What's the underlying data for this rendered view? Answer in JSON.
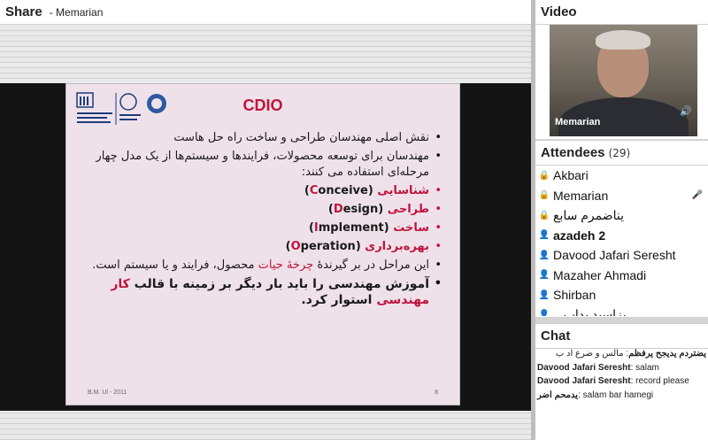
{
  "share": {
    "title": "Share",
    "presenter": "- Memarian",
    "slide": {
      "title": "CDIO",
      "bullets": [
        {
          "segments": [
            {
              "t": "نقش اصلی مهندسان طراحی و ساخت راه حل هاست"
            }
          ]
        },
        {
          "segments": [
            {
              "t": "مهندسان برای توسعه محصولات، فرایندها و سیستم‌ها از یک مدل چهار مرحله‌ای استفاده می کنند:"
            }
          ]
        },
        {
          "style": "red",
          "segments": [
            {
              "t": "شناسایی",
              "c": "r b"
            },
            {
              "t": " (",
              "c": "b"
            },
            {
              "t": "C",
              "c": "r b"
            },
            {
              "t": "onceive)",
              "c": "b"
            }
          ]
        },
        {
          "style": "red",
          "segments": [
            {
              "t": "طراحی",
              "c": "r b"
            },
            {
              "t": " (",
              "c": "b"
            },
            {
              "t": "D",
              "c": "r b"
            },
            {
              "t": "esign)",
              "c": "b"
            }
          ]
        },
        {
          "style": "red",
          "segments": [
            {
              "t": "ساخت",
              "c": "r b"
            },
            {
              "t": " (",
              "c": "b"
            },
            {
              "t": "I",
              "c": "r b"
            },
            {
              "t": "mplement)",
              "c": "b"
            }
          ]
        },
        {
          "style": "red",
          "segments": [
            {
              "t": "بهره‌برداری",
              "c": "r b"
            },
            {
              "t": " (",
              "c": "b"
            },
            {
              "t": "O",
              "c": "r b"
            },
            {
              "t": "peration)",
              "c": "b"
            }
          ]
        },
        {
          "segments": [
            {
              "t": "این مراحل در بر گیرندهٔ "
            },
            {
              "t": "چرخهٔ حیات",
              "c": "r"
            },
            {
              "t": " محصول، فرایند و یا سیستم است."
            }
          ]
        },
        {
          "style": "big",
          "segments": [
            {
              "t": "آموزش مهندسی را باید بار دیگر  بر زمینه با قالب "
            },
            {
              "t": "کار مهندسی",
              "c": "r"
            },
            {
              "t": " استوار کرد."
            }
          ]
        }
      ],
      "footer_left": "B.M. Ul - 2011",
      "page_number": "8"
    }
  },
  "video": {
    "title": "Video",
    "camera_name": "Memarian"
  },
  "attendees": {
    "title": "Attendees",
    "count": "(29)",
    "list": [
      {
        "name": "Akbari",
        "icon": "host-icon",
        "bold": false
      },
      {
        "name": "Memarian",
        "icon": "host-icon",
        "bold": false,
        "mic": true
      },
      {
        "name": "یناضمرم سابع",
        "icon": "host-icon",
        "bold": false,
        "rtl": true
      },
      {
        "name": "azadeh 2",
        "icon": "presenter-icon",
        "bold": true
      },
      {
        "name": "Davood Jafari Seresht",
        "icon": "participant-icon",
        "bold": false
      },
      {
        "name": "Mazaher Ahmadi",
        "icon": "participant-icon",
        "bold": false
      },
      {
        "name": "Shirban",
        "icon": "participant-icon",
        "bold": false
      },
      {
        "name": "یزاسید یداپ...",
        "icon": "participant-icon",
        "bold": false,
        "rtl": true
      }
    ]
  },
  "chat": {
    "title": "Chat",
    "messages": [
      {
        "sender": "یضتردم یدیجح یرفظم",
        "text": "مالس و ضرع اد ب",
        "rtl": true
      },
      {
        "sender": "Davood Jafari Seresht",
        "text": "salam"
      },
      {
        "sender": "Davood Jafari Seresht",
        "text": "record please"
      },
      {
        "sender": "یدمحم اضر",
        "text": "salam bar hamegi"
      }
    ]
  },
  "colors": {
    "accent_red": "#c0143c",
    "slide_bg": "#efe1ea",
    "host_icon": "#b8860b",
    "participant_icon": "#6a8fd8"
  }
}
